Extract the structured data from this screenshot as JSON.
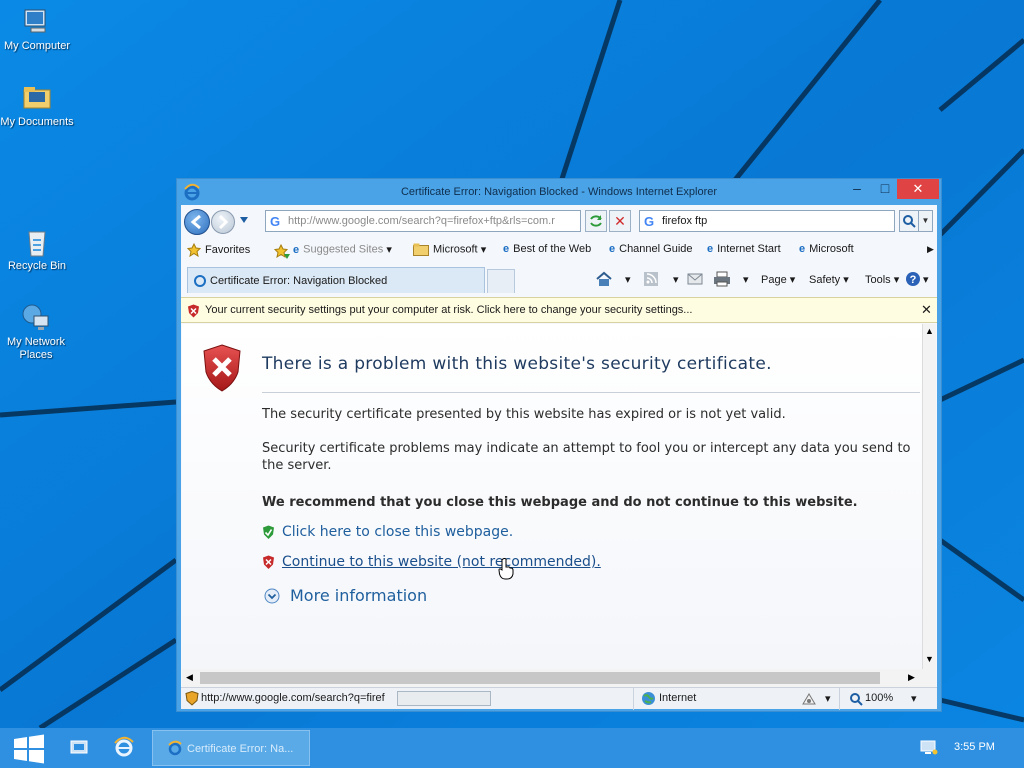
{
  "desktop": {
    "icons": [
      {
        "label": "My Computer",
        "icon": "computer-icon"
      },
      {
        "label": "My Documents",
        "icon": "folder-icon"
      },
      {
        "label": "Recycle Bin",
        "icon": "recycle-bin-icon"
      },
      {
        "label": "My Network Places",
        "icon": "network-icon"
      }
    ]
  },
  "window": {
    "title": "Certificate Error: Navigation Blocked - Windows Internet Explorer",
    "app_icon": "ie-icon"
  },
  "navbar": {
    "address": "http://www.google.com/search?q=firefox+ftp&rls=com.r",
    "search_value": "firefox ftp"
  },
  "favorites": {
    "label": "Favorites",
    "items": [
      {
        "label": "Suggested Sites",
        "dropdown": true
      },
      {
        "label": "Microsoft",
        "dropdown": true
      },
      {
        "label": "Best of the Web"
      },
      {
        "label": "Channel Guide"
      },
      {
        "label": "Internet Start"
      },
      {
        "label": "Microsoft"
      }
    ]
  },
  "tabs": {
    "active": "Certificate Error: Navigation Blocked"
  },
  "commandbar": {
    "page": "Page",
    "safety": "Safety",
    "tools": "Tools"
  },
  "infobar": {
    "text": "Your current security settings put your computer at risk. Click here to change your security settings..."
  },
  "error_page": {
    "heading": "There is a problem with this website's security certificate.",
    "p1": "The security certificate presented by this website has expired or is not yet valid.",
    "p2": "Security certificate problems may indicate an attempt to fool you or intercept any data you send to the server.",
    "recommend": "We recommend that you close this webpage and do not continue to this website.",
    "close_link": "Click here to close this webpage.",
    "continue_link": "Continue to this website (not recommended).",
    "more_info": "More information"
  },
  "statusbar": {
    "url": "http://www.google.com/search?q=firef",
    "zone": "Internet",
    "zoom": "100%"
  },
  "taskbar": {
    "window_label": "Certificate Error: Na...",
    "clock": "3:55 PM"
  },
  "colors": {
    "desktop": "#0a7ad9",
    "titlebar": "#4aa3e6",
    "close_button": "#e04343",
    "link": "#1f5f9e",
    "infobar": "#fffde1"
  }
}
